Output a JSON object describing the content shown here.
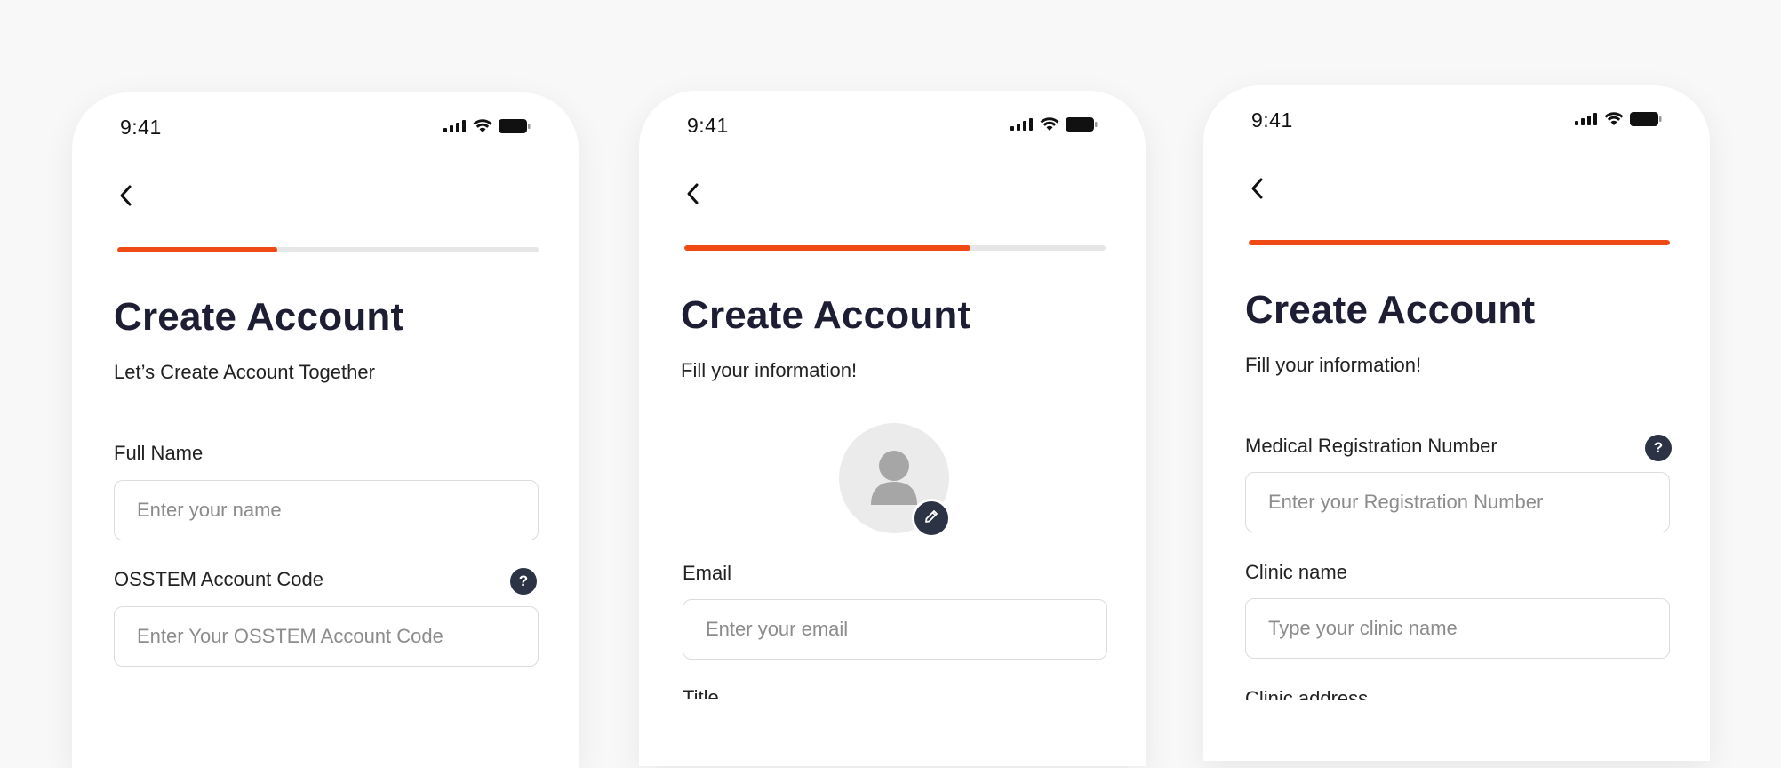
{
  "colors": {
    "accent": "#f04a14",
    "dark": "#1d1d33",
    "help_bg": "#2c3345"
  },
  "icons": {
    "back": "chevron-left-icon",
    "help": "question-icon",
    "signal": "signal-icon",
    "wifi": "wifi-icon",
    "battery": "battery-icon",
    "avatar": "person-icon",
    "edit": "pencil-icon"
  },
  "screens": [
    {
      "time": "9:41",
      "progress": 0.38,
      "title": "Create Account",
      "subtitle": "Let’s Create Account Together",
      "fields": [
        {
          "label": "Full Name",
          "placeholder": "Enter your name"
        },
        {
          "label": "OSSTEM Account Code",
          "placeholder": "Enter Your OSSTEM Account Code",
          "help": "?"
        }
      ]
    },
    {
      "time": "9:41",
      "progress": 0.68,
      "title": "Create Account",
      "subtitle": "Fill your information!",
      "fields": [
        {
          "label": "Email",
          "placeholder": "Enter your email"
        },
        {
          "label": "Title"
        }
      ]
    },
    {
      "time": "9:41",
      "progress": 1.0,
      "title": "Create Account",
      "subtitle": "Fill your information!",
      "fields": [
        {
          "label": "Medical Registration Number",
          "placeholder": "Enter your Registration Number",
          "help": "?"
        },
        {
          "label": "Clinic name",
          "placeholder": "Type your clinic name"
        },
        {
          "label": "Clinic address"
        }
      ]
    }
  ]
}
